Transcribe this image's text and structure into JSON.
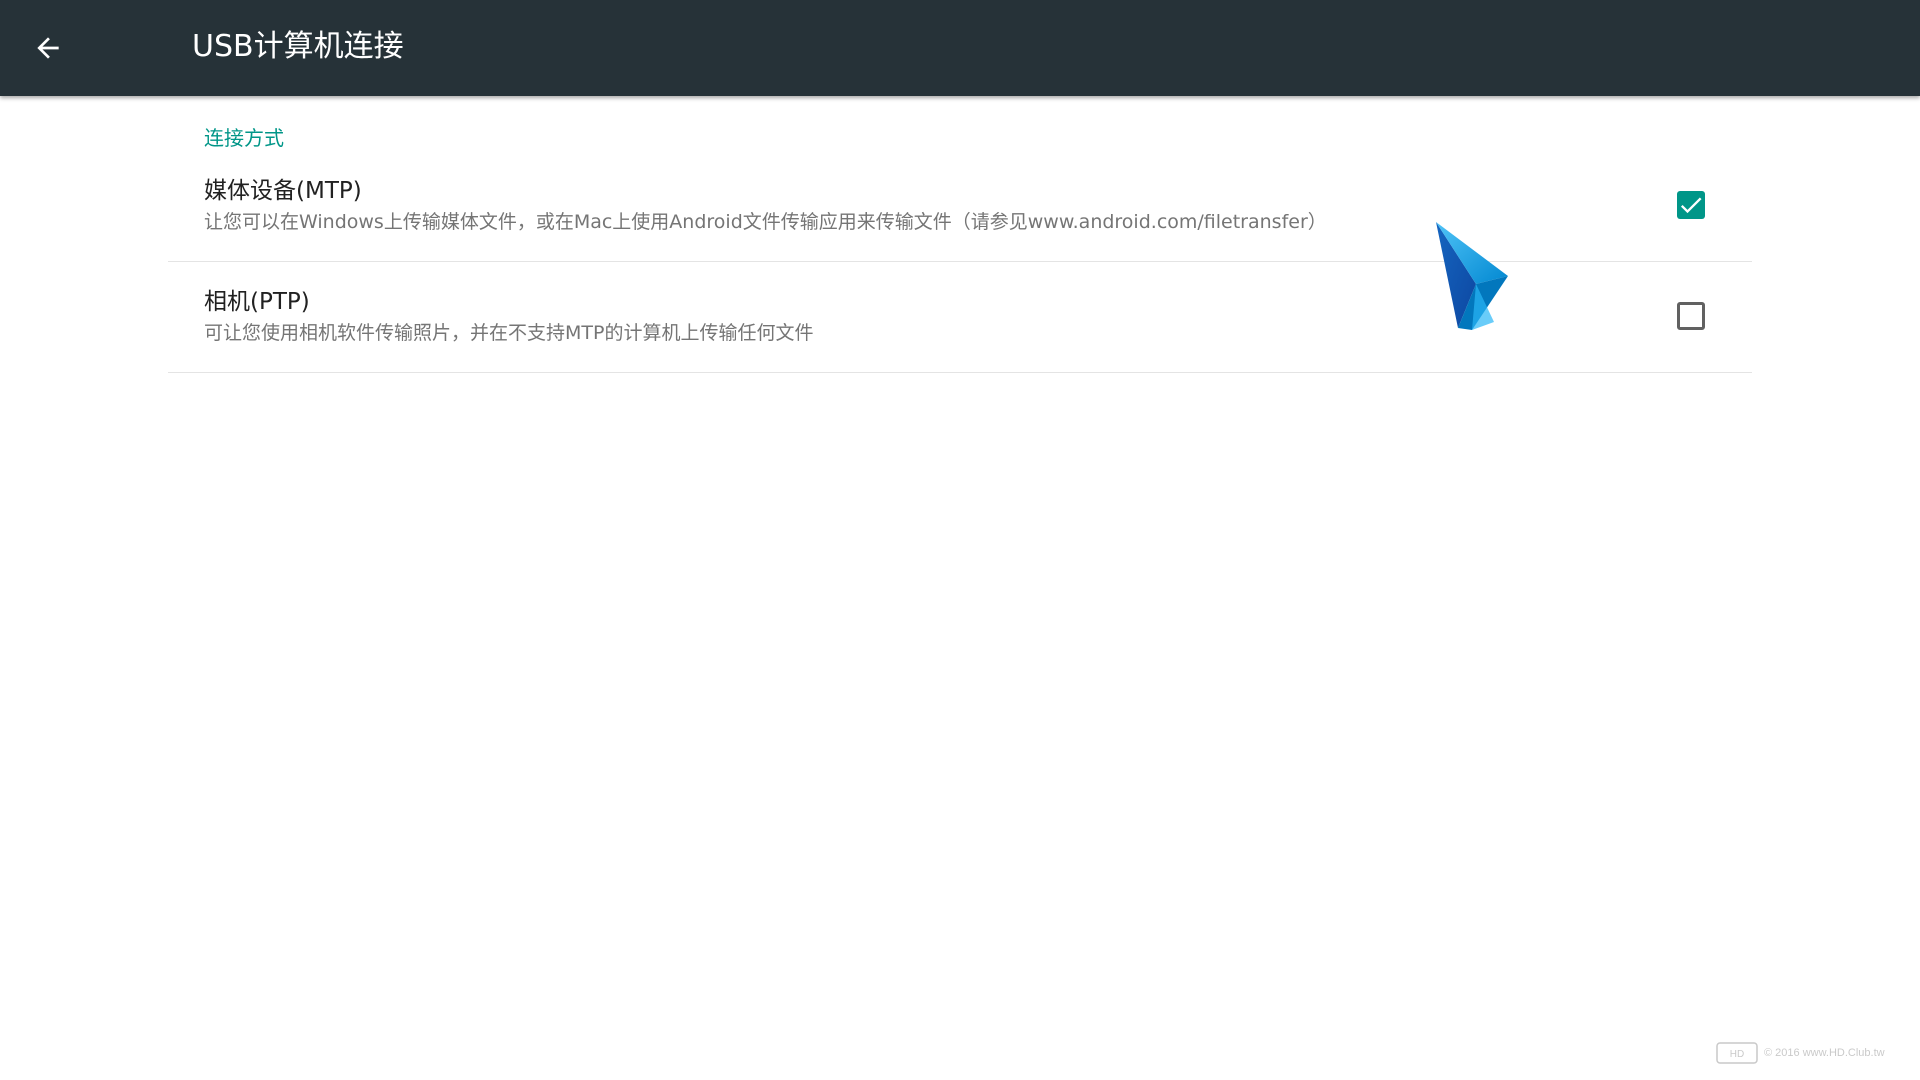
{
  "appbar": {
    "title": "USB计算机连接",
    "back_icon": "arrow-back-icon",
    "background": "#263238"
  },
  "section": {
    "category_title": "连接方式",
    "accent": "#009688",
    "options": [
      {
        "title": "媒体设备(MTP)",
        "summary": "让您可以在Windows上传输媒体文件，或在Mac上使用Android文件传输应用来传输文件（请参见www.android.com/filetransfer）",
        "checked": true
      },
      {
        "title": "相机(PTP)",
        "summary": "可让您使用相机软件传输照片，并在不支持MTP的计算机上传输任何文件",
        "checked": false
      }
    ]
  },
  "pointer": {
    "icon": "mouse-pointer-icon"
  },
  "watermark": {
    "logo_text": "HD CLUB",
    "text": "© 2016 www.HD.Club.tw"
  }
}
